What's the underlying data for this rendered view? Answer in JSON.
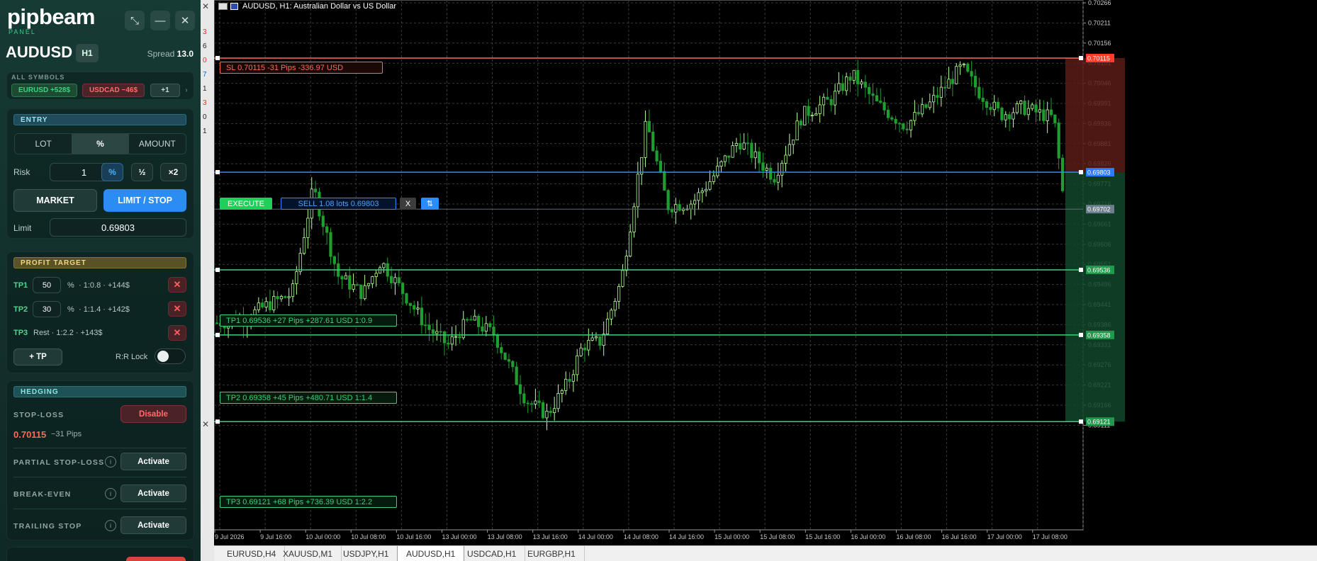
{
  "panel": {
    "brand": "pipbeam",
    "brand_sub": "PANEL",
    "symbol": "AUDUSD",
    "timeframe": "H1",
    "spread_label": "Spread",
    "spread_value": "13.0",
    "header_icons": [
      "shrink-icon",
      "minimize-icon",
      "close-icon"
    ],
    "header_glyphs": {
      "shrink": "⤡",
      "minimize": "—",
      "close": "✕"
    },
    "all_symbols": {
      "label": "ALL SYMBOLS",
      "pills": [
        {
          "text": "EURUSD +528$",
          "color": "#3fd17f"
        },
        {
          "text": "USDCAD −46$",
          "color": "#ff6b6b"
        },
        {
          "text": "+1",
          "color": "#cfdad7"
        }
      ],
      "more": "›"
    },
    "entry": {
      "header": "ENTRY",
      "modes": [
        "LOT",
        "%",
        "AMOUNT"
      ],
      "active_mode": "%",
      "risk_label": "Risk",
      "risk_value": "1",
      "risk_buttons": [
        "%",
        "½",
        "×2"
      ],
      "market_label": "MARKET",
      "limit_stop_label": "LIMIT / STOP",
      "limit_label": "Limit",
      "limit_value": "0.69803"
    },
    "profit": {
      "header": "PROFIT TARGET",
      "targets": [
        {
          "label": "TP1",
          "pct": "50",
          "pct_sign": "%",
          "info": "· 1:0.8 · +144$",
          "remove": "✕"
        },
        {
          "label": "TP2",
          "pct": "30",
          "pct_sign": "%",
          "info": "· 1:1.4 · +142$",
          "remove": "✕"
        },
        {
          "label": "TP3",
          "info": "Rest · 1:2.2 · +143$",
          "remove": "✕"
        }
      ],
      "add_tp": "+ TP",
      "rr_lock": "R:R Lock"
    },
    "hedging": {
      "header": "HEDGING",
      "stop_loss_label": "STOP-LOSS",
      "disable_label": "Disable",
      "sl_price": "0.70115",
      "sl_pips": "−31 Pips",
      "rows": [
        {
          "label": "PARTIAL STOP-LOSS",
          "action": "Activate"
        },
        {
          "label": "BREAK-EVEN",
          "action": "Activate"
        },
        {
          "label": "TRAILING STOP",
          "action": "Activate"
        }
      ],
      "info_glyph": "i"
    }
  },
  "strip": {
    "numbers": [
      {
        "text": "3",
        "color": "#d32"
      },
      {
        "text": "6",
        "color": "#222"
      },
      {
        "text": "0",
        "color": "#d32"
      },
      {
        "text": "7",
        "color": "#1a5fd0"
      },
      {
        "text": "1",
        "color": "#222"
      },
      {
        "text": "3",
        "color": "#d32"
      },
      {
        "text": "0",
        "color": "#222"
      },
      {
        "text": "1",
        "color": "#222"
      }
    ],
    "close_glyph": "✕"
  },
  "chart": {
    "title": "AUDUSD, H1:  Australian Dollar vs US Dollar",
    "price_labels": [
      "0.70266",
      "0.70211",
      "0.70156",
      "0.70101",
      "0.70046",
      "0.69991",
      "0.69936",
      "0.69881",
      "0.69826",
      "0.69771",
      "0.69716",
      "0.69661",
      "0.69606",
      "0.69551",
      "0.69496",
      "0.69441",
      "0.69386",
      "0.69331",
      "0.69276",
      "0.69221",
      "0.69166",
      "0.69111"
    ],
    "time_labels": [
      "9 Jul 2026",
      "9 Jul 16:00",
      "10 Jul 00:00",
      "10 Jul 08:00",
      "10 Jul 16:00",
      "13 Jul 00:00",
      "13 Jul 08:00",
      "13 Jul 16:00",
      "14 Jul 00:00",
      "14 Jul 08:00",
      "14 Jul 16:00",
      "15 Jul 00:00",
      "15 Jul 08:00",
      "15 Jul 16:00",
      "16 Jul 00:00",
      "16 Jul 08:00",
      "16 Jul 16:00",
      "17 Jul 00:00",
      "17 Jul 08:00"
    ],
    "markers": {
      "sl": "0.70115",
      "entry": "0.69803",
      "bid": "0.69702",
      "tp1": "0.69536",
      "tp2": "0.69358",
      "tp3": "0.69121"
    },
    "colors": {
      "sl": "#ff6b57",
      "entry": "#2b8cff",
      "tp": "#3fcf78",
      "grid": "#3a3a3a",
      "bull": "#b6ff9a",
      "bear": "#1f9e2f"
    },
    "overlays": {
      "sl": "SL   0.70115   -31 Pips   -336.97 USD",
      "execute": "EXECUTE",
      "order": "SELL   1.08 lots   0.69803",
      "cancel": "X",
      "flip": "⇅",
      "tp1": "TP1   0.69536   +27 Pips   +287.61 USD   1:0.9",
      "tp2": "TP2   0.69358   +45 Pips   +480.71 USD   1:1.4",
      "tp3": "TP3   0.69121   +68 Pips   +736.39 USD   1:2.2"
    }
  },
  "tabs": [
    {
      "label": "EURUSD,H4",
      "active": false
    },
    {
      "label": "XAUUSD,M1",
      "active": false
    },
    {
      "label": "USDJPY,H1",
      "active": false
    },
    {
      "label": "AUDUSD,H1",
      "active": true
    },
    {
      "label": "USDCAD,H1",
      "active": false
    },
    {
      "label": "EURGBP,H1",
      "active": false
    }
  ]
}
